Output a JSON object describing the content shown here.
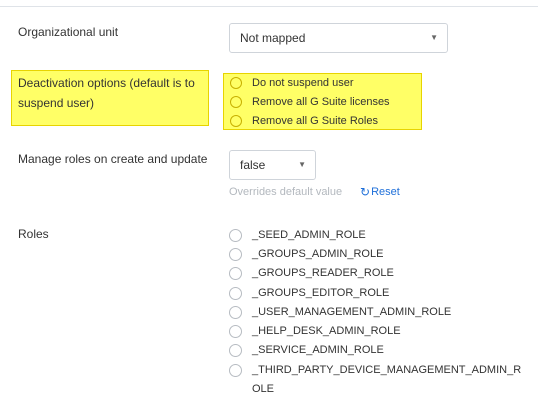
{
  "org_unit": {
    "label": "Organizational unit",
    "value": "Not mapped",
    "caret": "▼"
  },
  "deactivation": {
    "label": "Deactivation options (default is to suspend user)",
    "options": [
      "Do not suspend user",
      "Remove all G Suite licenses",
      "Remove all G Suite Roles"
    ],
    "highlight_color": "#ffff66"
  },
  "manage_roles": {
    "label": "Manage roles on create and update",
    "value": "false",
    "caret": "▼",
    "hint": "Overrides default value",
    "reset_icon": "↻",
    "reset_label": "Reset"
  },
  "roles": {
    "label": "Roles",
    "items": [
      "_SEED_ADMIN_ROLE",
      "_GROUPS_ADMIN_ROLE",
      "_GROUPS_READER_ROLE",
      "_GROUPS_EDITOR_ROLE",
      "_USER_MANAGEMENT_ADMIN_ROLE",
      "_HELP_DESK_ADMIN_ROLE",
      "_SERVICE_ADMIN_ROLE",
      "_THIRD_PARTY_DEVICE_MANAGEMENT_ADMIN_ROLE"
    ]
  },
  "colors": {
    "link": "#1e6fd9",
    "hint": "#b3b8be",
    "border": "#cfd4da"
  }
}
